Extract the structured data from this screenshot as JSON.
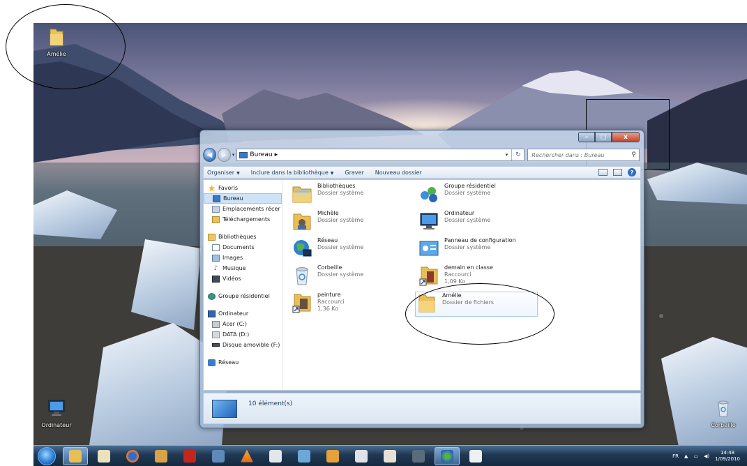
{
  "desktop": {
    "icons": {
      "amelie": "Amélie",
      "ordinateur": "Ordinateur",
      "corbeille": "Corbeille"
    }
  },
  "window": {
    "address": {
      "crumb": "Bureau",
      "separator": "▸"
    },
    "search": {
      "placeholder": "Rechercher dans : Bureau"
    },
    "caption": {
      "minimize": "–",
      "maximize": "□",
      "close": "x"
    },
    "toolbar": {
      "organiser": "Organiser",
      "inclure": "Inclure dans la bibliothèque",
      "graver": "Graver",
      "nouveau_dossier": "Nouveau dossier"
    },
    "navpane": {
      "favoris": "Favoris",
      "bureau": "Bureau",
      "emplacements": "Emplacements récer",
      "telechargements": "Téléchargements",
      "bibliotheques": "Bibliothèques",
      "documents": "Documents",
      "images": "Images",
      "musique": "Musique",
      "videos": "Vidéos",
      "groupe": "Groupe résidentiel",
      "ordinateur": "Ordinateur",
      "acer": "Acer (C:)",
      "data": "DATA (D:)",
      "disque": "Disque amovible (F:)",
      "reseau": "Réseau"
    },
    "files": [
      {
        "name": "Bibliothèques",
        "sub1": "Dossier système",
        "sub2": ""
      },
      {
        "name": "Groupe résidentiel",
        "sub1": "Dossier système",
        "sub2": ""
      },
      {
        "name": "Michèle",
        "sub1": "Dossier système",
        "sub2": ""
      },
      {
        "name": "Ordinateur",
        "sub1": "Dossier système",
        "sub2": ""
      },
      {
        "name": "Réseau",
        "sub1": "Dossier système",
        "sub2": ""
      },
      {
        "name": "Panneau de configuration",
        "sub1": "Dossier système",
        "sub2": ""
      },
      {
        "name": "Corbeille",
        "sub1": "Dossier système",
        "sub2": ""
      },
      {
        "name": "demain en classe",
        "sub1": "Raccourci",
        "sub2": "1,09 Ko"
      },
      {
        "name": "peinture",
        "sub1": "Raccourci",
        "sub2": "1,36 Ko"
      },
      {
        "name": "Amélie",
        "sub1": "Dossier de fichiers",
        "sub2": ""
      }
    ],
    "status": {
      "count": "10 élément(s)"
    }
  },
  "taskbar": {
    "tray": {
      "lang": "FR",
      "time": "14:48",
      "date": "1/09/2010"
    }
  },
  "colors": {
    "selection": "#cce3f8",
    "window_frame": "#c6d6eb",
    "taskbar": "#1f3853"
  }
}
